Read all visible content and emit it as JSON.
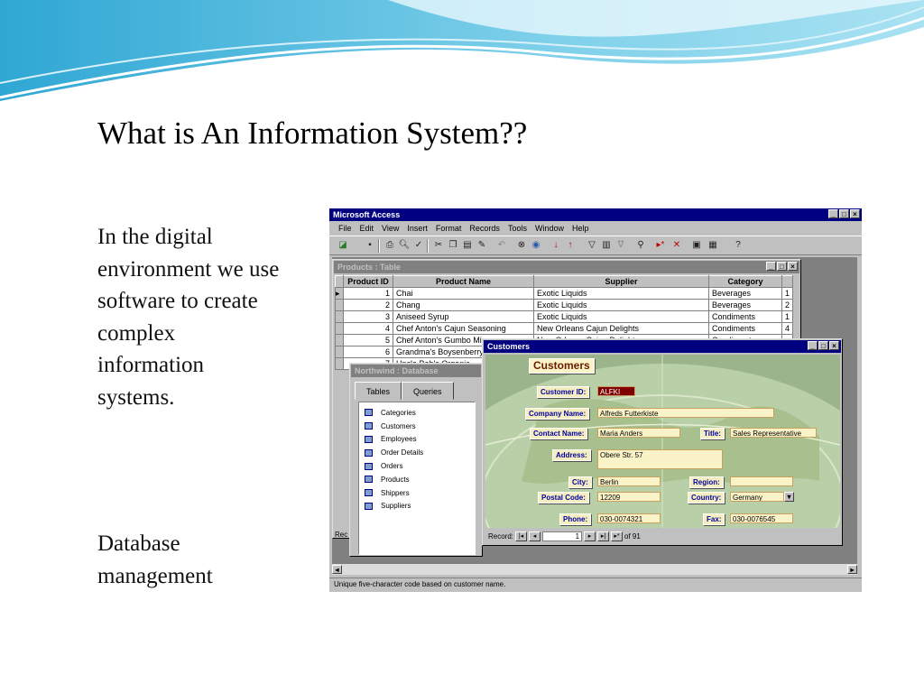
{
  "slide": {
    "title": "What is An Information System??",
    "body_lines": [
      "In the digital",
      "environment we use",
      "software to create",
      "complex",
      "information",
      "systems."
    ],
    "body2_lines": [
      "Database",
      "management"
    ]
  },
  "access": {
    "app_title": "Microsoft Access",
    "menu": [
      "File",
      "Edit",
      "View",
      "Insert",
      "Format",
      "Records",
      "Tools",
      "Window",
      "Help"
    ],
    "products": {
      "title": "Products : Table",
      "columns": [
        "Product ID",
        "Product Name",
        "Supplier",
        "Category"
      ],
      "rows": [
        [
          "1",
          "Chai",
          "Exotic Liquids",
          "Beverages",
          "1"
        ],
        [
          "2",
          "Chang",
          "Exotic Liquids",
          "Beverages",
          "2"
        ],
        [
          "3",
          "Aniseed Syrup",
          "Exotic Liquids",
          "Condiments",
          "1"
        ],
        [
          "4",
          "Chef Anton's Cajun Seasoning",
          "New Orleans Cajun Delights",
          "Condiments",
          "4"
        ],
        [
          "5",
          "Chef Anton's Gumbo Mix",
          "New Orleans Cajun Delights",
          "Condiments",
          ""
        ],
        [
          "6",
          "Grandma's Boysenberry Spread",
          "",
          "",
          ""
        ],
        [
          "7",
          "Uncle Bob's Organic",
          "",
          "",
          ""
        ]
      ],
      "record_label": "Rec"
    },
    "northwind": {
      "title": "Northwind : Database",
      "tabs": [
        "Tables",
        "Queries"
      ],
      "tables": [
        "Categories",
        "Customers",
        "Employees",
        "Order Details",
        "Orders",
        "Products",
        "Shippers",
        "Suppliers"
      ]
    },
    "customers": {
      "title": "Customers",
      "header": "Customers",
      "fields": {
        "customer_id": {
          "label": "Customer ID:",
          "value": "ALFKI"
        },
        "company_name": {
          "label": "Company Name:",
          "value": "Alfreds Futterkiste"
        },
        "contact_name": {
          "label": "Contact Name:",
          "value": "Maria Anders"
        },
        "title": {
          "label": "Title:",
          "value": "Sales Representative"
        },
        "address": {
          "label": "Address:",
          "value": "Obere Str. 57"
        },
        "city": {
          "label": "City:",
          "value": "Berlin"
        },
        "region": {
          "label": "Region:",
          "value": ""
        },
        "postal_code": {
          "label": "Postal Code:",
          "value": "12209"
        },
        "country": {
          "label": "Country:",
          "value": "Germany"
        },
        "phone": {
          "label": "Phone:",
          "value": "030-0074321"
        },
        "fax": {
          "label": "Fax:",
          "value": "030-0076545"
        }
      },
      "nav": {
        "label": "Record:",
        "current": "1",
        "of_text": "of  91"
      }
    },
    "status": "Unique five-character code based on customer name."
  },
  "colors": {
    "titlebar": "#000080",
    "form_background": "#9cb48c",
    "field_background": "#fbf3c8",
    "wave_blue": "#4fb3d9"
  }
}
